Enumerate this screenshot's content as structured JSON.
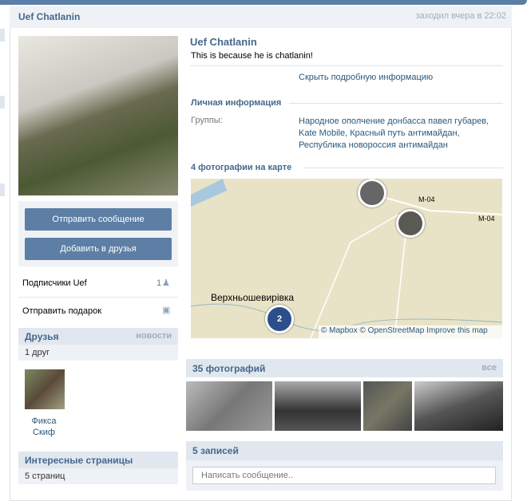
{
  "header": {
    "name": "Uef Chatlanin",
    "last_seen": "заходил вчера в 22:02"
  },
  "left": {
    "send_message": "Отправить сообщение",
    "add_friend": "Добавить в друзья",
    "subscribers_label": "Подписчики Uef",
    "subscribers_count": "1",
    "send_gift": "Отправить подарок",
    "friends": {
      "title": "Друзья",
      "link": "новости",
      "count": "1 друг",
      "items": [
        {
          "first": "Фикса",
          "last": "Скиф"
        }
      ]
    },
    "pages": {
      "title": "Интересные страницы",
      "count": "5 страниц"
    }
  },
  "profile": {
    "name": "Uef Chatlanin",
    "status": "This is because he is chatlanin!",
    "hide_info": "Скрыть подробную информацию",
    "personal_title": "Личная информация",
    "groups_label": "Группы:",
    "groups": [
      "Народное ополчение донбасса павел губарев,",
      "Kate Mobile, Красный путь антимайдан,",
      "Республика новороссия антимайдан"
    ]
  },
  "map": {
    "title": "4 фотографии на карте",
    "place": "Верхньошевирівка",
    "road1": "M-04",
    "road2": "M-04",
    "cluster_count": "2",
    "credit_mapbox": "© Mapbox",
    "credit_osm": "© OpenStreetMap",
    "improve": "Improve this map"
  },
  "photos": {
    "title": "35 фотографий",
    "all": "все"
  },
  "wall": {
    "title": "5 записей",
    "placeholder": "Написать сообщение.."
  }
}
